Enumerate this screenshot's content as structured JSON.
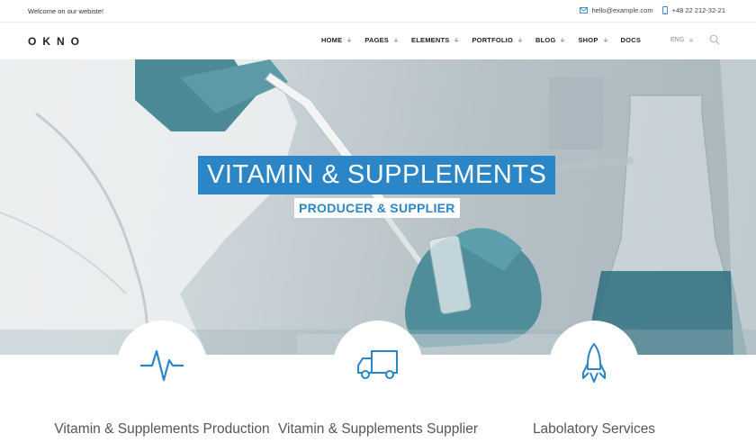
{
  "topbar": {
    "welcome": "Welcome on our webiste!",
    "email": "hello@example.com",
    "phone": "+48 22 212-32-21"
  },
  "nav": {
    "logo": "OKNO",
    "items": [
      {
        "label": "HOME",
        "dropdown": true
      },
      {
        "label": "PAGES",
        "dropdown": true
      },
      {
        "label": "ELEMENTS",
        "dropdown": true
      },
      {
        "label": "PORTFOLIO",
        "dropdown": true
      },
      {
        "label": "BLOG",
        "dropdown": true
      },
      {
        "label": "SHOP",
        "dropdown": true
      },
      {
        "label": "DOCS",
        "dropdown": false
      }
    ],
    "language": "ENG",
    "icons": {
      "search": "search-icon",
      "email": "envelope-icon",
      "phone": "phone-icon"
    }
  },
  "hero": {
    "title": "VITAMIN & SUPPLEMENTS",
    "subtitle": "PRODUCER & SUPPLIER"
  },
  "features": [
    {
      "icon": "heartbeat-icon",
      "label": "Vitamin & Supplements Production"
    },
    {
      "icon": "truck-icon",
      "label": "Vitamin & Supplements Supplier"
    },
    {
      "icon": "rocket-icon",
      "label": "Labolatory Services"
    }
  ],
  "colors": {
    "accent": "#2a86c6",
    "text": "#333333",
    "muted": "#888888"
  }
}
